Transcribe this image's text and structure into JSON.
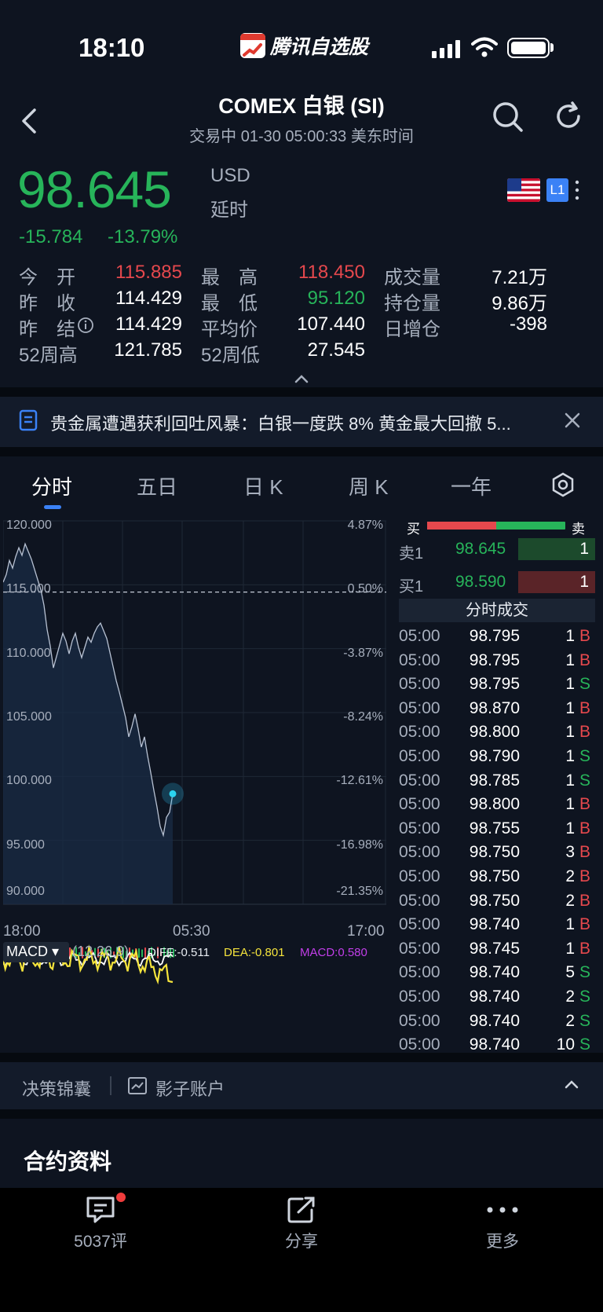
{
  "status": {
    "time": "18:10",
    "app_name": "腾讯自选股"
  },
  "header": {
    "title": "COMEX 白银 (SI)",
    "subtitle": "交易中   01-30 05:00:33 美东时间"
  },
  "quote": {
    "price": "98.645",
    "currency": "USD",
    "delay": "延时",
    "change": "-15.784",
    "change_pct": "-13.79%",
    "level": "L1"
  },
  "stats": [
    [
      {
        "l": "今　开",
        "v": "115.885",
        "c": "red"
      },
      {
        "l": "最　高",
        "v": "118.450",
        "c": "red"
      },
      {
        "l": "成交量",
        "v": "7.21万",
        "c": "white"
      }
    ],
    [
      {
        "l": "昨　收",
        "v": "114.429",
        "c": "white"
      },
      {
        "l": "最　低",
        "v": "95.120",
        "c": "green"
      },
      {
        "l": "持仓量",
        "v": "9.86万",
        "c": "white"
      }
    ],
    [
      {
        "l": "昨　结",
        "v": "114.429",
        "c": "white"
      },
      {
        "l": "平均价",
        "v": "107.440",
        "c": "white"
      },
      {
        "l": "日增仓",
        "v": "-398",
        "c": "white"
      }
    ],
    [
      {
        "l": "52周高",
        "v": "121.785",
        "c": "white"
      },
      {
        "l": "52周低",
        "v": "27.545",
        "c": "white"
      },
      {
        "l": "",
        "v": "",
        "c": "white"
      }
    ]
  ],
  "news": {
    "text": "贵金属遭遇获利回吐风暴：白银一度跌 8% 黄金最大回撤 5..."
  },
  "tabs": [
    "分时",
    "五日",
    "日 K",
    "周 K",
    "一年"
  ],
  "chart_data": {
    "type": "line",
    "y_left_ticks": [
      "120.000",
      "115.000",
      "110.000",
      "105.000",
      "100.000",
      "95.000",
      "90.000"
    ],
    "y_right_ticks": [
      "4.87%",
      "0.50%",
      "-3.87%",
      "-8.24%",
      "-12.61%",
      "-16.98%",
      "-21.35%"
    ],
    "x_ticks": [
      "18:00",
      "05:30",
      "17:00"
    ],
    "ylim": [
      90,
      120
    ],
    "prev_settle": 114.429,
    "series": [
      {
        "values": [
          115.2,
          115.8,
          116.9,
          116.3,
          117.2,
          117.9,
          117.3,
          118.2,
          117.6,
          117.0,
          116.2,
          115.4,
          114.6,
          113.4,
          111.5,
          110.2,
          108.5,
          109.4,
          110.3,
          111.2,
          110.6,
          109.6,
          110.6,
          111.2,
          110.1,
          109.3,
          110.1,
          110.9,
          110.5,
          111.2,
          111.7,
          112.0,
          111.4,
          110.8,
          109.7,
          108.6,
          107.5,
          106.6,
          105.6,
          104.6,
          103.1,
          103.9,
          104.9,
          103.7,
          102.3,
          103.1,
          101.6,
          100.3,
          98.9,
          97.6,
          96.1,
          95.4,
          96.8,
          97.2,
          98.645
        ]
      }
    ],
    "macd": {
      "params": "(12,26,9)",
      "diff": "DIFF:-0.511",
      "dea": "DEA:-0.801",
      "macd": "MACD:0.580"
    }
  },
  "orderbook": {
    "buy_label": "买",
    "sell_label": "卖",
    "ask": {
      "label": "卖1",
      "price": "98.645",
      "qty": "1"
    },
    "bid": {
      "label": "买1",
      "price": "98.590",
      "qty": "1"
    }
  },
  "tape": {
    "title": "分时成交",
    "rows": [
      {
        "t": "05:00",
        "p": "98.795",
        "q": "1",
        "s": "B"
      },
      {
        "t": "05:00",
        "p": "98.795",
        "q": "1",
        "s": "B"
      },
      {
        "t": "05:00",
        "p": "98.795",
        "q": "1",
        "s": "S"
      },
      {
        "t": "05:00",
        "p": "98.870",
        "q": "1",
        "s": "B"
      },
      {
        "t": "05:00",
        "p": "98.800",
        "q": "1",
        "s": "B"
      },
      {
        "t": "05:00",
        "p": "98.790",
        "q": "1",
        "s": "S"
      },
      {
        "t": "05:00",
        "p": "98.785",
        "q": "1",
        "s": "S"
      },
      {
        "t": "05:00",
        "p": "98.800",
        "q": "1",
        "s": "B"
      },
      {
        "t": "05:00",
        "p": "98.755",
        "q": "1",
        "s": "B"
      },
      {
        "t": "05:00",
        "p": "98.750",
        "q": "3",
        "s": "B"
      },
      {
        "t": "05:00",
        "p": "98.750",
        "q": "2",
        "s": "B"
      },
      {
        "t": "05:00",
        "p": "98.750",
        "q": "2",
        "s": "B"
      },
      {
        "t": "05:00",
        "p": "98.740",
        "q": "1",
        "s": "B"
      },
      {
        "t": "05:00",
        "p": "98.745",
        "q": "1",
        "s": "B"
      },
      {
        "t": "05:00",
        "p": "98.740",
        "q": "5",
        "s": "S"
      },
      {
        "t": "05:00",
        "p": "98.740",
        "q": "2",
        "s": "S"
      },
      {
        "t": "05:00",
        "p": "98.740",
        "q": "2",
        "s": "S"
      },
      {
        "t": "05:00",
        "p": "98.740",
        "q": "10",
        "s": "S"
      }
    ]
  },
  "tools": {
    "decision": "决策锦囊",
    "shadow": "影子账户"
  },
  "section": {
    "title": "合约资料"
  },
  "nav": {
    "comments": "5037评",
    "share": "分享",
    "more": "更多"
  },
  "colors": {
    "up": "#e5484d",
    "down": "#27b45a",
    "bg": "#0e1420",
    "accent": "#3b82f6"
  }
}
